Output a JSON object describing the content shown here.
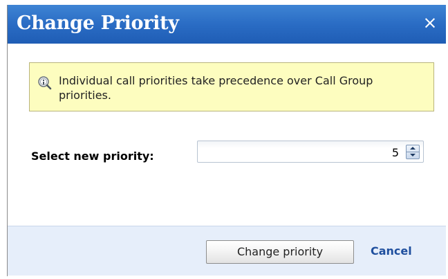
{
  "dialog": {
    "title": "Change Priority",
    "close_label": "×"
  },
  "info": {
    "icon": "info-magnifier-icon",
    "text": "Individual call priorities take precedence over Call Group priorities."
  },
  "priority": {
    "label": "Select new priority:",
    "value": "5"
  },
  "footer": {
    "change_label": "Change priority",
    "cancel_label": "Cancel"
  },
  "colors": {
    "titlebar": "#2a6cc4",
    "info_background": "#fdfdbf",
    "footer_background": "#e6eefa",
    "cancel_link": "#1f4f9e"
  }
}
